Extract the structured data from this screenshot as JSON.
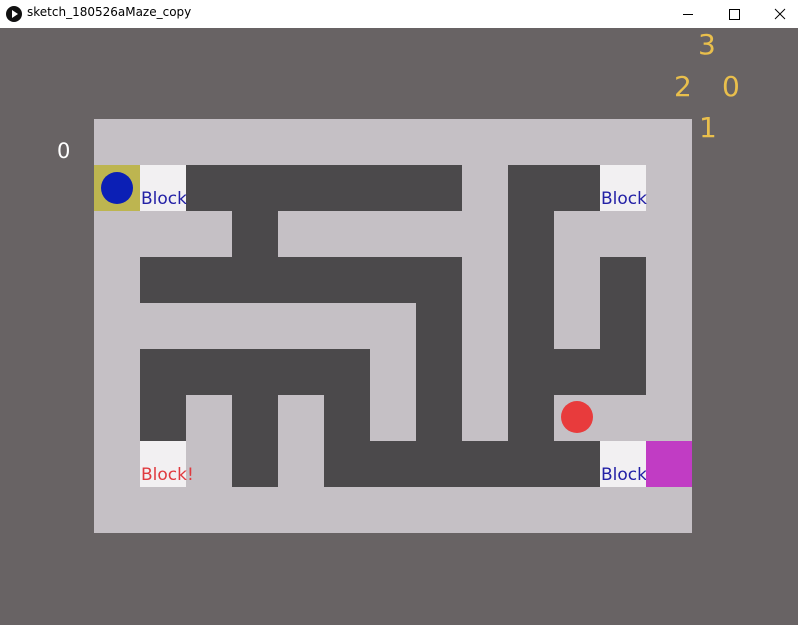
{
  "window": {
    "title": "sketch_180526aMaze_copy"
  },
  "game": {
    "score": "0",
    "direction_numbers": {
      "up": "3",
      "left": "2",
      "right": "0",
      "down": "1"
    },
    "blocks": [
      {
        "label": "Block",
        "variant": "blue"
      },
      {
        "label": "Block",
        "variant": "blue"
      },
      {
        "label": "Block!",
        "variant": "red"
      },
      {
        "label": "Block",
        "variant": "blue"
      }
    ]
  },
  "colors": {
    "canvas_bg": "#686364",
    "maze_floor": "#c5c0c5",
    "wall": "#4b494b",
    "player": "#0b1fb5",
    "enemy": "#e83b3c",
    "goal": "#c13cc4",
    "start_cell": "#bdb550",
    "direction_text": "#e9bf4c"
  }
}
